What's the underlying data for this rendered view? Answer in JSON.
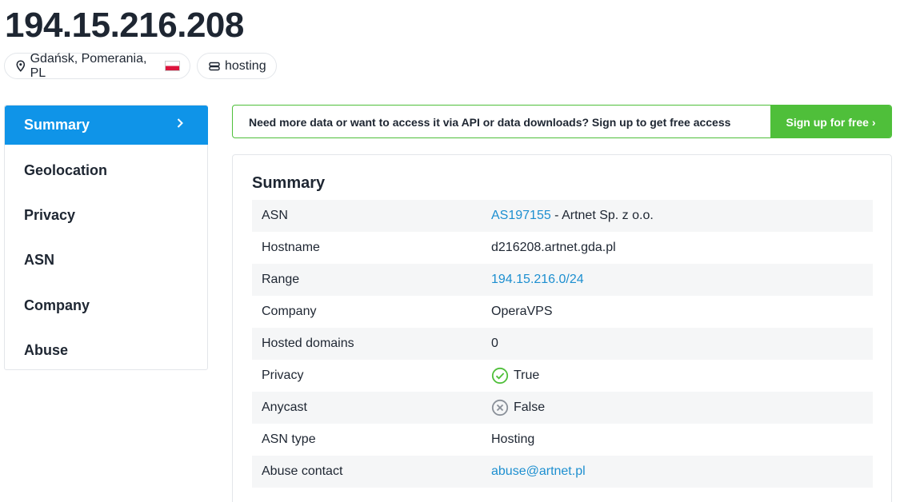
{
  "header": {
    "ip": "194.15.216.208",
    "location": "Gdańsk, Pomerania, PL",
    "tag": "hosting"
  },
  "sidebar": {
    "items": [
      {
        "label": "Summary",
        "active": true
      },
      {
        "label": "Geolocation"
      },
      {
        "label": "Privacy"
      },
      {
        "label": "ASN"
      },
      {
        "label": "Company"
      },
      {
        "label": "Abuse"
      }
    ]
  },
  "banner": {
    "text": "Need more data or want to access it via API or data downloads? Sign up to get free access",
    "button": "Sign up for free ›"
  },
  "summary": {
    "title": "Summary",
    "rows": [
      {
        "key": "ASN",
        "link": "AS197155",
        "rest": " - Artnet Sp. z o.o."
      },
      {
        "key": "Hostname",
        "value": "d216208.artnet.gda.pl"
      },
      {
        "key": "Range",
        "link": "194.15.216.0/24"
      },
      {
        "key": "Company",
        "value": "OperaVPS"
      },
      {
        "key": "Hosted domains",
        "value": "0"
      },
      {
        "key": "Privacy",
        "value": "True",
        "icon": "check-circle-icon"
      },
      {
        "key": "Anycast",
        "value": "False",
        "icon": "x-circle-icon"
      },
      {
        "key": "ASN type",
        "value": "Hosting"
      },
      {
        "key": "Abuse contact",
        "link": "abuse@artnet.pl"
      }
    ]
  },
  "colors": {
    "accent": "#0f94e8",
    "success": "#4fbf3a",
    "link": "#1d8fd0"
  }
}
